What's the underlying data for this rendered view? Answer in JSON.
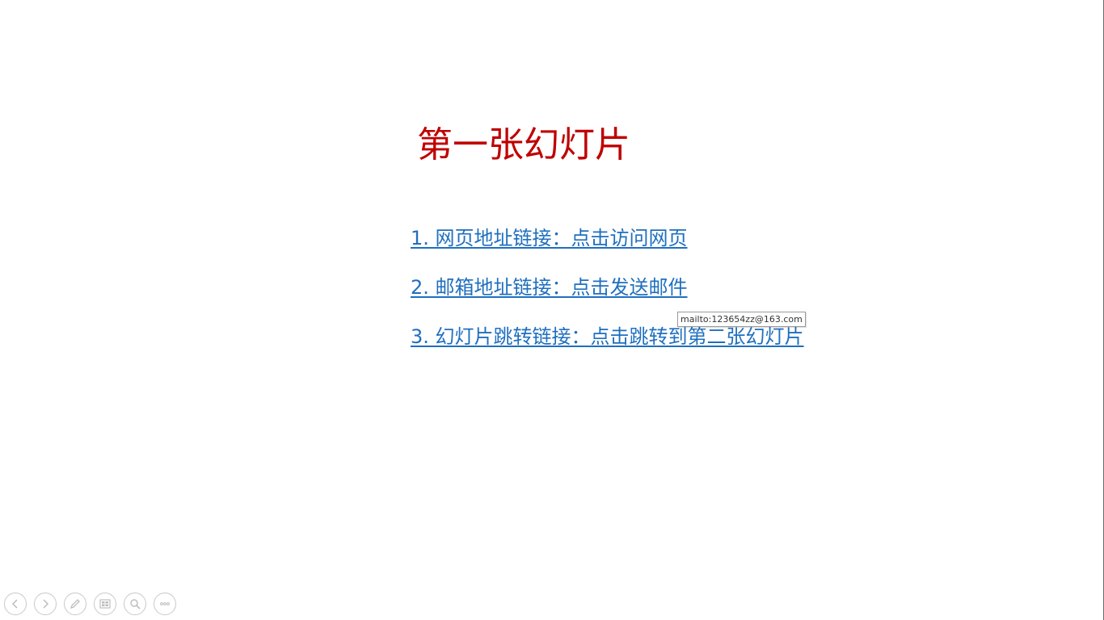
{
  "slide": {
    "title": "第一张幻灯片",
    "title_color": "#c00000",
    "links": [
      {
        "label": "1. 网页地址链接：点击访问网页"
      },
      {
        "label": "2. 邮箱地址链接：点击发送邮件"
      },
      {
        "label": "3. 幻灯片跳转链接：点击跳转到第二张幻灯片"
      }
    ],
    "link_color": "#1f6fbf"
  },
  "tooltip": {
    "text": "mailto:123654zz@163.com"
  },
  "toolbar": {
    "buttons": [
      {
        "icon": "previous-icon"
      },
      {
        "icon": "next-icon"
      },
      {
        "icon": "pen-icon"
      },
      {
        "icon": "all-slides-icon"
      },
      {
        "icon": "zoom-icon"
      },
      {
        "icon": "more-options-icon"
      }
    ]
  }
}
